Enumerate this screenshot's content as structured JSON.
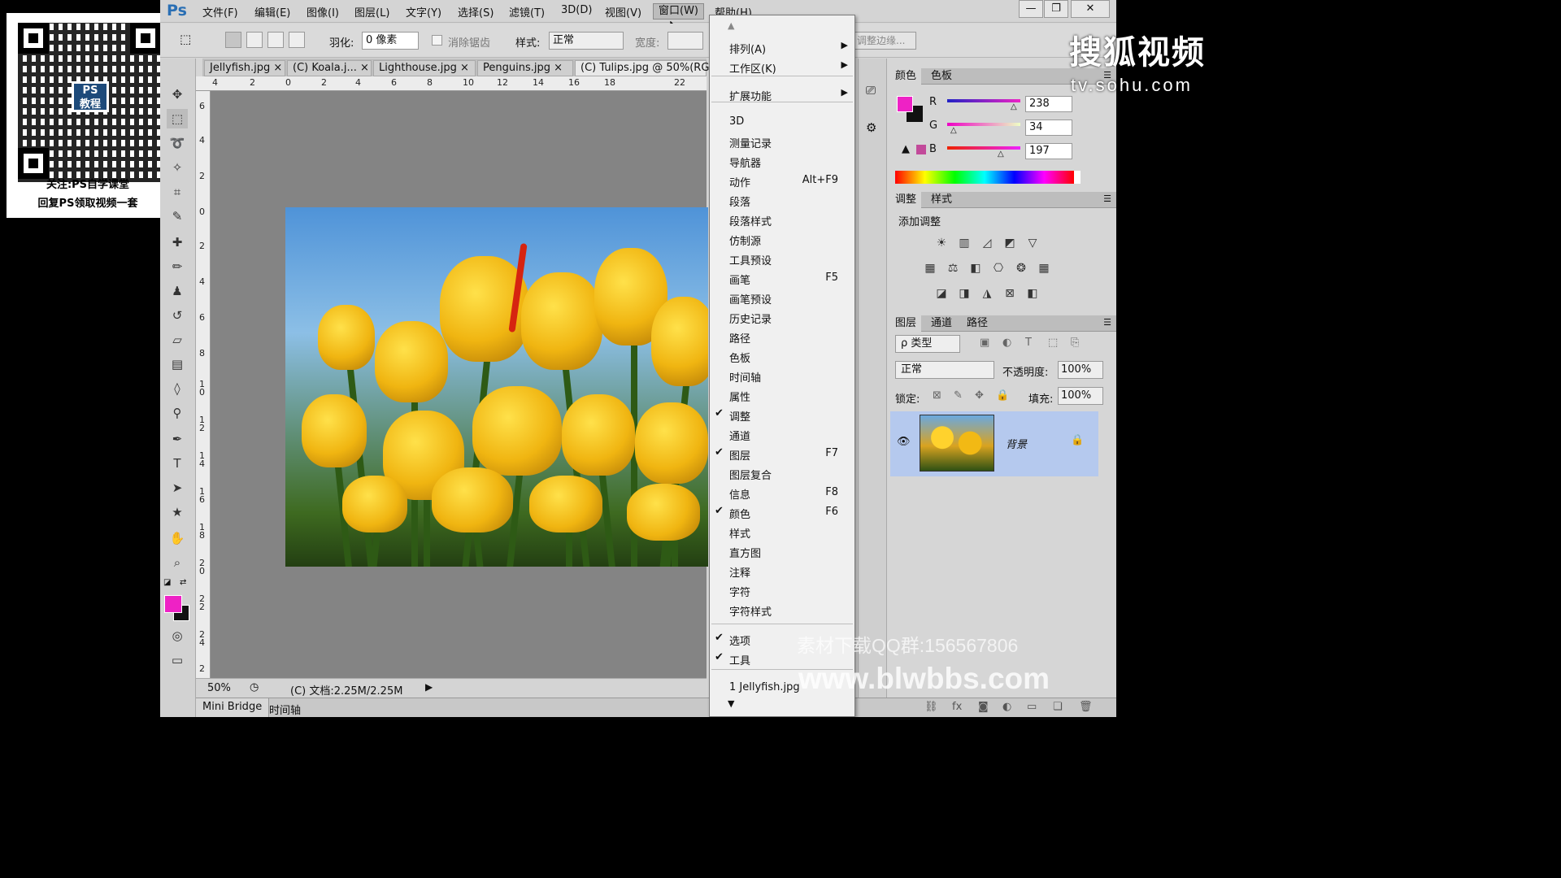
{
  "qr_card": {
    "line1": "关注:PS自学课堂",
    "line2": "回复PS领取视频一套",
    "badge": "PS\n教程"
  },
  "app": {
    "logo": "Ps"
  },
  "menubar": {
    "items": [
      "文件(F)",
      "编辑(E)",
      "图像(I)",
      "图层(L)",
      "文字(Y)",
      "选择(S)",
      "滤镜(T)",
      "3D(D)",
      "视图(V)",
      "窗口(W)",
      "帮助(H)"
    ],
    "active": "窗口(W)"
  },
  "window_controls": {
    "minimize": "—",
    "restore": "❐",
    "close": "✕"
  },
  "options": {
    "feather_label": "羽化:",
    "feather_value": "0 像素",
    "antialias_label": "消除锯齿",
    "style_label": "样式:",
    "style_value": "正常",
    "width_label": "宽度:",
    "refine_edge": "调整边缘..."
  },
  "doc_tabs": [
    "Jellyfish.jpg",
    "(C) Koala.j...",
    "Lighthouse.jpg",
    "Penguins.jpg",
    "(C) Tulips.jpg @ 50%(RGB"
  ],
  "ruler": {
    "h": [
      "4",
      "2",
      "0",
      "2",
      "4",
      "6",
      "8",
      "10",
      "12",
      "14",
      "16",
      "18",
      "22"
    ],
    "v": [
      "6",
      "4",
      "2",
      "0",
      "2",
      "4",
      "6",
      "8",
      "1\n0",
      "1\n2",
      "1\n4",
      "1\n6",
      "1\n8",
      "2\n0",
      "2\n2",
      "2\n4",
      "2"
    ]
  },
  "status": {
    "zoom": "50%",
    "doc": "(C) 文档:2.25M/2.25M"
  },
  "bottom_tabs": [
    "Mini Bridge",
    "时间轴"
  ],
  "window_menu": [
    {
      "label": "排列(A)",
      "submenu": true
    },
    {
      "label": "工作区(K)",
      "submenu": true
    },
    {
      "sep": true
    },
    {
      "label": "扩展功能",
      "submenu": true
    },
    {
      "sep": true
    },
    {
      "label": "3D"
    },
    {
      "label": "测量记录"
    },
    {
      "label": "导航器"
    },
    {
      "label": "动作",
      "shortcut": "Alt+F9"
    },
    {
      "label": "段落"
    },
    {
      "label": "段落样式"
    },
    {
      "label": "仿制源"
    },
    {
      "label": "工具预设"
    },
    {
      "label": "画笔",
      "shortcut": "F5"
    },
    {
      "label": "画笔预设"
    },
    {
      "label": "历史记录"
    },
    {
      "label": "路径"
    },
    {
      "label": "色板"
    },
    {
      "label": "时间轴"
    },
    {
      "label": "属性"
    },
    {
      "label": "调整",
      "checked": true
    },
    {
      "label": "通道"
    },
    {
      "label": "图层",
      "checked": true,
      "shortcut": "F7"
    },
    {
      "label": "图层复合"
    },
    {
      "label": "信息",
      "shortcut": "F8"
    },
    {
      "label": "颜色",
      "checked": true,
      "shortcut": "F6"
    },
    {
      "label": "样式"
    },
    {
      "label": "直方图"
    },
    {
      "label": "注释"
    },
    {
      "label": "字符"
    },
    {
      "label": "字符样式"
    },
    {
      "sep": true
    },
    {
      "label": "选项",
      "checked": true
    },
    {
      "label": "工具",
      "checked": true
    },
    {
      "sep": true
    },
    {
      "label": "1 Jellyfish.jpg"
    }
  ],
  "color_panel": {
    "tabs": [
      "颜色",
      "色板"
    ],
    "r_label": "R",
    "g_label": "G",
    "b_label": "B",
    "r": "238",
    "g": "34",
    "b": "197",
    "fg_color": "#ee22c5"
  },
  "adjust_panel": {
    "tabs": [
      "调整",
      "样式"
    ],
    "title": "添加调整"
  },
  "layers_panel": {
    "tabs": [
      "图层",
      "通道",
      "路径"
    ],
    "filter": "ρ 类型",
    "blend": "正常",
    "opacity_label": "不透明度:",
    "opacity": "100%",
    "lock_label": "锁定:",
    "fill_label": "填充:",
    "fill": "100%",
    "layer_name": "背景"
  },
  "watermarks": {
    "sohu": "搜狐视频",
    "sohu_url": "tv.sohu.com",
    "qq": "素材下载QQ群:156567806",
    "site": "www.blwbbs.com"
  }
}
